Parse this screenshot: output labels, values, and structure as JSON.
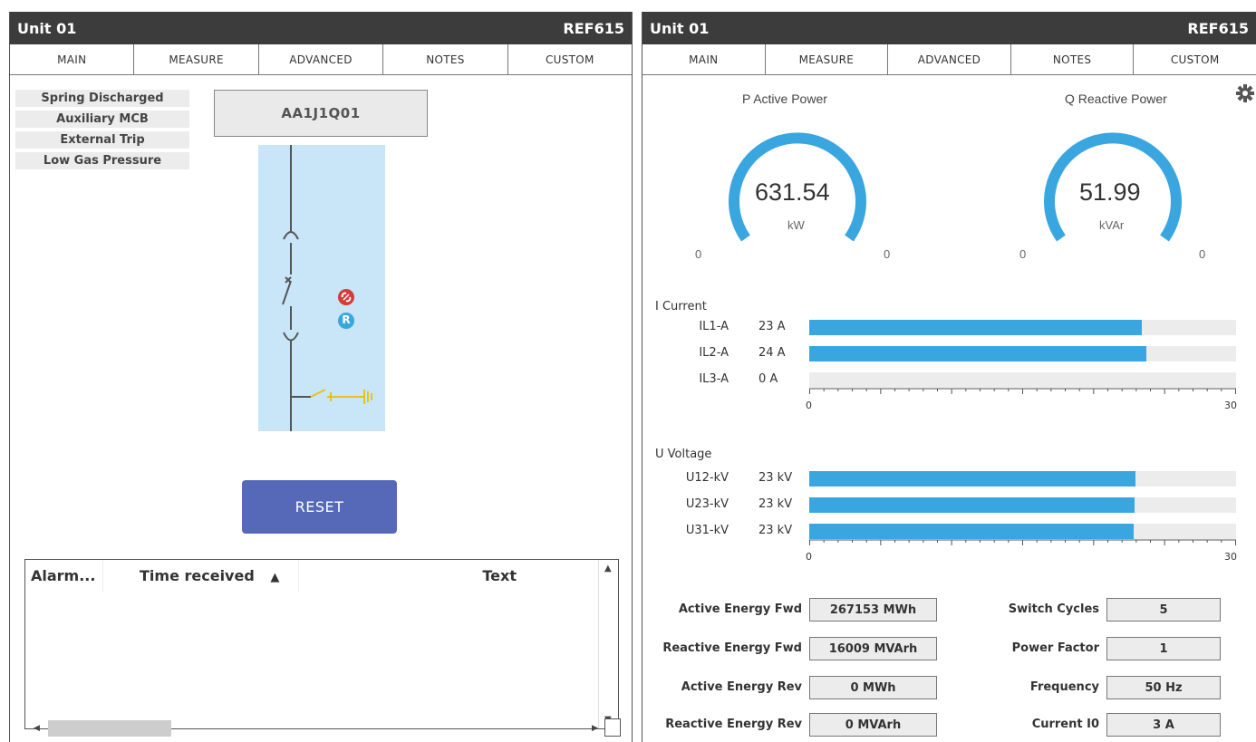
{
  "left": {
    "title": "Unit 01",
    "model": "REF615",
    "tabs": [
      "MAIN",
      "MEASURE",
      "ADVANCED",
      "NOTES",
      "CUSTOM"
    ],
    "indicators": [
      "Spring Discharged",
      "Auxiliary MCB",
      "External Trip",
      "Low Gas Pressure"
    ],
    "device": "AA1J1Q01",
    "badge_r": "R",
    "reset_label": "RESET",
    "alarm_table": {
      "col_alarm": "Alarm...",
      "col_time": "Time received",
      "col_text": "Text"
    }
  },
  "right": {
    "title": "Unit 01",
    "model": "REF615",
    "tabs": [
      "MAIN",
      "MEASURE",
      "ADVANCED",
      "NOTES",
      "CUSTOM"
    ],
    "gauges": [
      {
        "title": "P Active Power",
        "value": "631.54",
        "unit": "kW",
        "min": "0",
        "max": "0"
      },
      {
        "title": "Q Reactive Power",
        "value": "51.99",
        "unit": "kVAr",
        "min": "0",
        "max": "0"
      }
    ],
    "current": {
      "title": "I Current",
      "axis_min": "0",
      "axis_max": "30",
      "rows": [
        {
          "label": "IL1-A",
          "value": "23 A",
          "fraction": 0.78
        },
        {
          "label": "IL2-A",
          "value": "24 A",
          "fraction": 0.79
        },
        {
          "label": "IL3-A",
          "value": "0 A",
          "fraction": 0
        }
      ]
    },
    "voltage": {
      "title": "U Voltage",
      "axis_min": "0",
      "axis_max": "30",
      "rows": [
        {
          "label": "U12-kV",
          "value": "23 kV",
          "fraction": 0.765
        },
        {
          "label": "U23-kV",
          "value": "23 kV",
          "fraction": 0.763
        },
        {
          "label": "U31-kV",
          "value": "23 kV",
          "fraction": 0.76
        }
      ]
    },
    "fields_left": [
      {
        "label": "Active Energy Fwd",
        "value": "267153 MWh"
      },
      {
        "label": "Reactive Energy Fwd",
        "value": "16009 MVArh"
      },
      {
        "label": "Active Energy Rev",
        "value": "0 MWh"
      },
      {
        "label": "Reactive Energy Rev",
        "value": "0 MVArh"
      }
    ],
    "fields_right": [
      {
        "label": "Switch Cycles",
        "value": "5"
      },
      {
        "label": "Power Factor",
        "value": "1"
      },
      {
        "label": "Frequency",
        "value": "50 Hz"
      },
      {
        "label": "Current I0",
        "value": "3 A"
      }
    ]
  },
  "colors": {
    "titlebar": "#3c3c3c",
    "bar_fill": "#3aa6df",
    "sld_background": "#c8e6f8",
    "reset_button": "#5569b8"
  }
}
